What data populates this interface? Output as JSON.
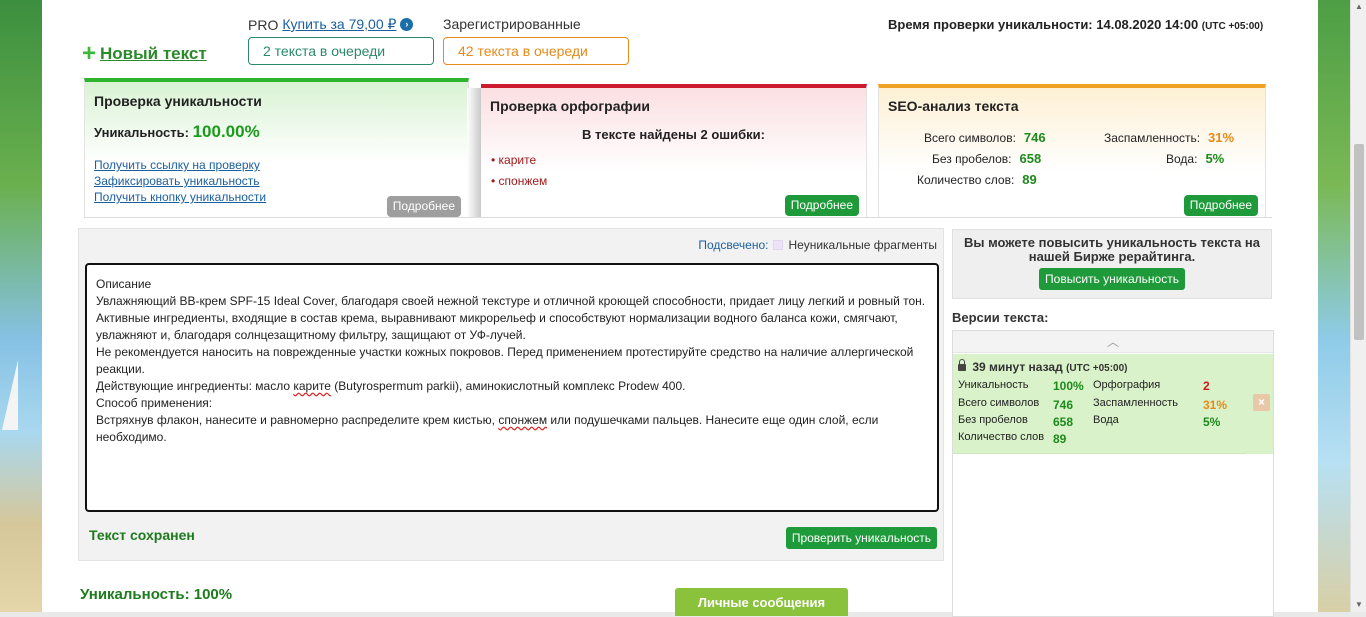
{
  "header": {
    "new_text_label": "Новый текст",
    "pro_label": "PRO",
    "buy_label": "Купить за 79,00 ₽",
    "registered_label": "Зарегистрированные",
    "queue_pro": "2 текста в очереди",
    "queue_registered": "42 текста в очереди",
    "check_time_label": "Время проверки уникальности: 14.08.2020 14:00",
    "check_time_utc": "(UTC +05:00)"
  },
  "uniqueness_panel": {
    "title": "Проверка уникальности",
    "label": "Уникальность:",
    "value": "100.00%",
    "links": [
      "Получить ссылку на проверку",
      "Зафиксировать уникальность",
      "Получить кнопку уникальности"
    ],
    "more_label": "Подробнее"
  },
  "spelling_panel": {
    "title": "Проверка орфографии",
    "subtitle": "В тексте найдены 2 ошибки:",
    "errors": [
      "карите",
      "спонжем"
    ],
    "more_label": "Подробнее"
  },
  "seo_panel": {
    "title": "SEO-анализ текста",
    "total_chars_label": "Всего символов:",
    "total_chars": "746",
    "no_spaces_label": "Без пробелов:",
    "no_spaces": "658",
    "words_label": "Количество слов:",
    "words": "89",
    "spam_label": "Заспамленность:",
    "spam": "31%",
    "water_label": "Вода:",
    "water": "5%",
    "more_label": "Подробнее"
  },
  "editor": {
    "highlight_label": "Подсвечено:",
    "highlight_legend": "Неуникальные фрагменты",
    "lines": [
      "Описание",
      "Увлажняющий BB-крем SPF-15 Ideal Cover, благодаря своей нежной текстуре и отличной кроющей способности, придает лицу легкий и ровный тон.",
      "Активные ингредиенты, входящие в состав крема, выравнивают микрорельеф и способствуют нормализации водного баланса кожи, смягчают, увлажняют и, благодаря солнцезащитному фильтру, защищают от УФ-лучей.",
      "Не рекомендуется наносить на поврежденные участки кожных покровов. Перед применением протестируйте средство на наличие аллергической реакции."
    ],
    "line5_before": "Действующие ингредиенты: масло ",
    "line5_mark": "карите",
    "line5_after": " (Butyrospermum parkii), аминокислотный комплекс Prodew 400.",
    "line6": "Способ применения:",
    "line7_before": "Встряхнув флакон, нанесите и равномерно распределите крем кистью, ",
    "line7_mark": "спонжем",
    "line7_after": " или подушечками пальцев. Нанесите еще один слой, если необходимо.",
    "saved_label": "Текст сохранен",
    "check_button": "Проверить уникальность"
  },
  "footer": {
    "uniqueness": "Уникальность: 100%",
    "messages_button": "Личные сообщения"
  },
  "promo": {
    "text": "Вы можете повысить уникальность текста на нашей Бирже рерайтинга.",
    "button": "Повысить уникальность"
  },
  "versions": {
    "title": "Версии текста:",
    "time": "39 минут назад",
    "utc": "(UTC +05:00)",
    "uniq_label": "Уникальность",
    "uniq": "100%",
    "spelling_label": "Орфография",
    "spelling": "2",
    "chars_label": "Всего символов",
    "chars": "746",
    "spam_label": "Заспамленность",
    "spam": "31%",
    "nospace_label": "Без пробелов",
    "nospace": "658",
    "water_label": "Вода",
    "water": "5%",
    "words_label": "Количество слов",
    "words": "89"
  }
}
